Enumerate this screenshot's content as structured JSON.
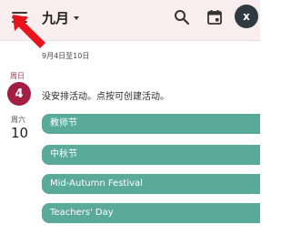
{
  "appbar": {
    "month_title": "九月",
    "avatar_initial": "x"
  },
  "agenda": {
    "week_range": "9月4日至10日",
    "days": [
      {
        "weekday": "周日",
        "date": "4",
        "empty_message": "没安排活动。点按可创建活动。"
      },
      {
        "weekday": "周六",
        "date": "10"
      }
    ],
    "events": [
      {
        "title": "教师节"
      },
      {
        "title": "中秋节"
      },
      {
        "title": "Mid-Autumn Festival"
      },
      {
        "title": "Teachers' Day"
      }
    ]
  },
  "colors": {
    "appbar_bg": "#f8eef0",
    "today_accent": "#a21e43",
    "event_color": "#5aaa9a",
    "annotation_arrow": "#e8131b"
  }
}
